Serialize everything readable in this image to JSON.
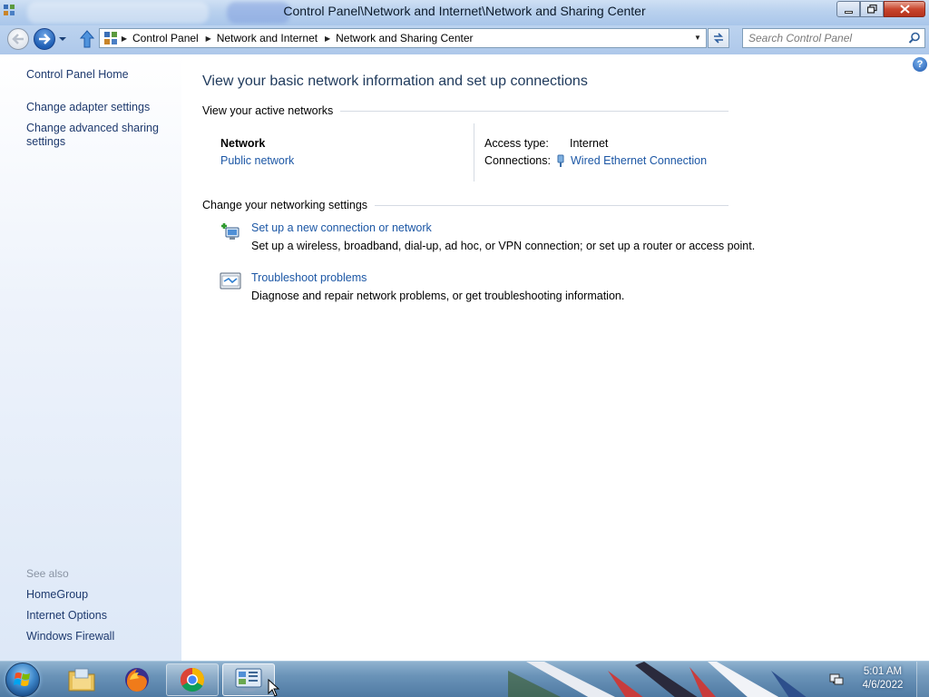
{
  "window": {
    "title": "Control Panel\\Network and Internet\\Network and Sharing Center"
  },
  "navbar": {
    "breadcrumbs": [
      "Control Panel",
      "Network and Internet",
      "Network and Sharing Center"
    ],
    "search_placeholder": "Search Control Panel"
  },
  "sidebar": {
    "home": "Control Panel Home",
    "links": [
      "Change adapter settings",
      "Change advanced sharing settings"
    ],
    "see_also_label": "See also",
    "see_also": [
      "HomeGroup",
      "Internet Options",
      "Windows Firewall"
    ]
  },
  "main": {
    "heading": "View your basic network information and set up connections",
    "active_networks_label": "View your active networks",
    "network": {
      "name": "Network",
      "type": "Public network",
      "access_type_label": "Access type:",
      "access_type_value": "Internet",
      "connections_label": "Connections:",
      "connections_value": "Wired Ethernet Connection"
    },
    "settings_label": "Change your networking settings",
    "tasks": [
      {
        "title": "Set up a new connection or network",
        "description": "Set up a wireless, broadband, dial-up, ad hoc, or VPN connection; or set up a router or access point."
      },
      {
        "title": "Troubleshoot problems",
        "description": "Diagnose and repair network problems, or get troubleshooting information."
      }
    ]
  },
  "taskbar": {
    "time": "5:01 AM",
    "date": "4/6/2022",
    "items": [
      "windows-explorer",
      "firefox",
      "chrome",
      "control-panel"
    ]
  },
  "colors": {
    "link": "#1c57a5",
    "heading": "#1e395b",
    "sidebar_link": "#1e3a6e"
  }
}
